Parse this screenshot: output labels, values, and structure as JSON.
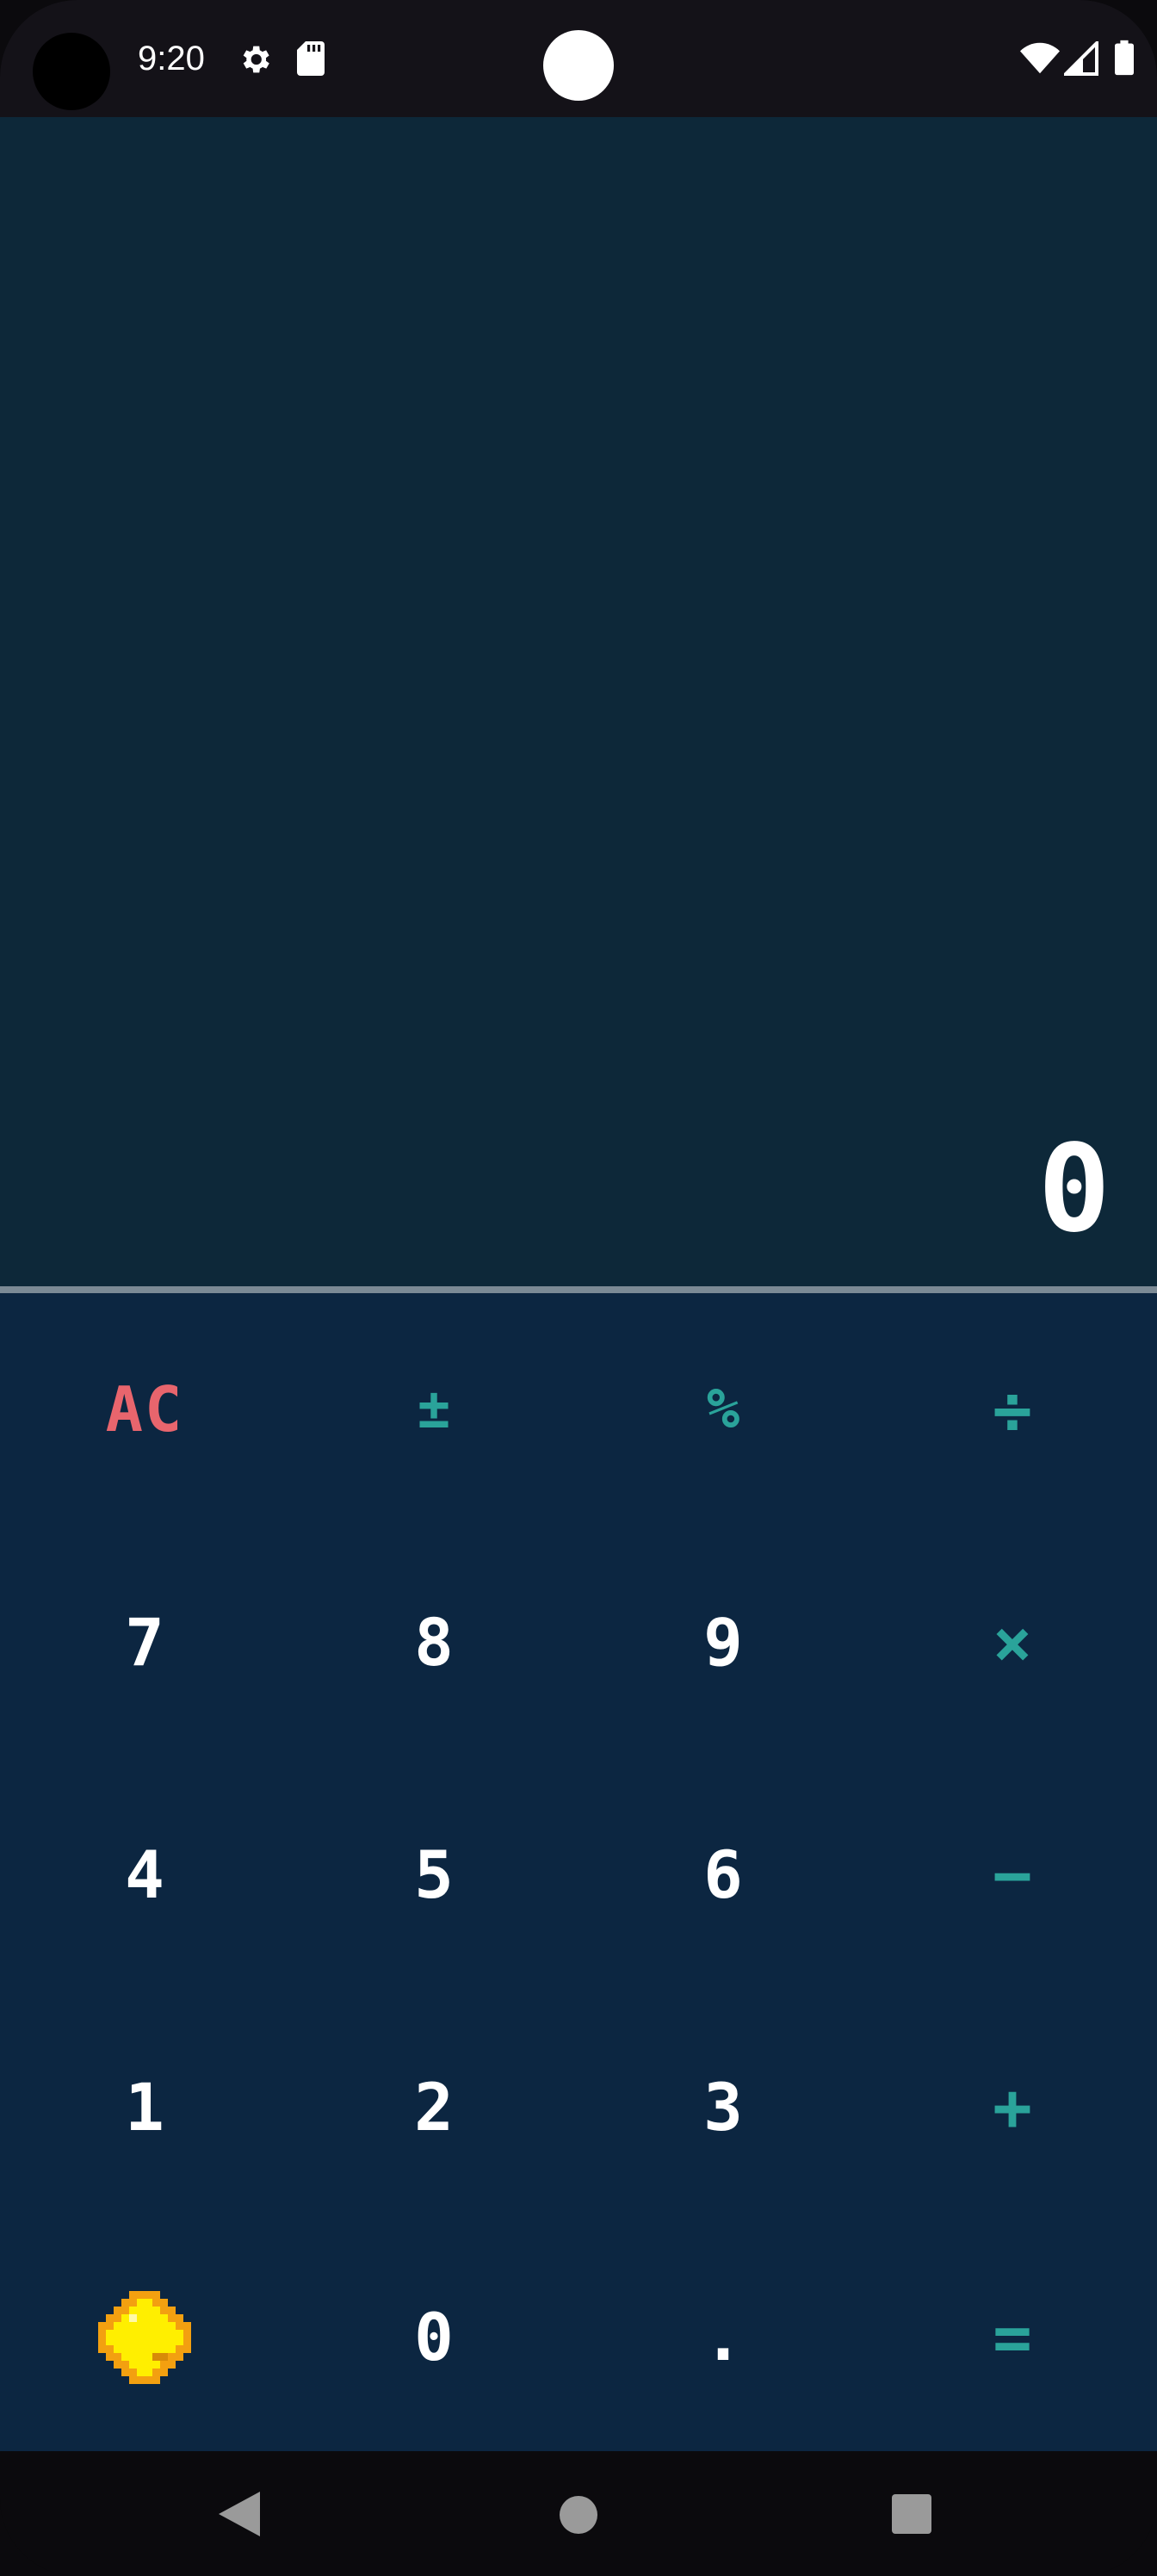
{
  "status_bar": {
    "time": "9:20",
    "icons": [
      "camera-hole",
      "gear-icon",
      "sd-card-icon",
      "dot-icon",
      "wifi-icon",
      "signal-icon",
      "battery-icon"
    ]
  },
  "display": {
    "value": "0"
  },
  "keypad": {
    "rows": [
      [
        "AC",
        "±",
        "%",
        "÷"
      ],
      [
        "7",
        "8",
        "9",
        "×"
      ],
      [
        "4",
        "5",
        "6",
        "−"
      ],
      [
        "1",
        "2",
        "3",
        "+"
      ],
      [
        "",
        "0",
        ".",
        "="
      ]
    ],
    "special_icon": "pixel-gem-icon"
  },
  "colors": {
    "display_bg": "#0d2839",
    "keypad_bg": "#0c2641",
    "digit": "#ffffff",
    "operator": "#2aa39a",
    "clear": "#e8656d",
    "gem": "#ffef00"
  },
  "nav_bar": {
    "buttons": [
      "back-icon",
      "home-icon",
      "recents-icon"
    ]
  }
}
